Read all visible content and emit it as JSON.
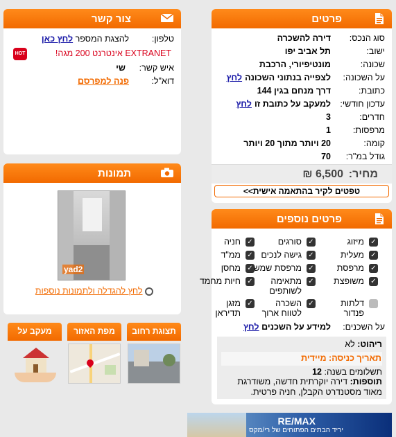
{
  "details": {
    "title": "פרטים",
    "rows": [
      {
        "label": "סוג הנכס:",
        "value": "דירה להשכרה"
      },
      {
        "label": "ישוב:",
        "value": "תל אביב יפו"
      },
      {
        "label": "שכונה:",
        "value": "מונטיפיורי, הרכבת"
      },
      {
        "label": "על השכונה:",
        "value": "לצפייה בנתוני השכונה",
        "link": "לחץ"
      },
      {
        "label": "כתובת:",
        "value": "דרך מנחם בגין 144"
      },
      {
        "label": "עדכון חודשי:",
        "value": "למעקב על כתובת זו",
        "link": "לחץ"
      },
      {
        "label": "חדרים:",
        "value": "3"
      },
      {
        "label": "מרפסות:",
        "value": "1"
      },
      {
        "label": "קומה:",
        "value": "20 ויותר מתוך 20 ויותר"
      },
      {
        "label": "גודל במ\"ר:",
        "value": "70"
      }
    ],
    "price_label": "מחיר:",
    "price_value": "6,500 ₪",
    "tips_button": "טפטים לקיר בהתאמה אישית>>"
  },
  "extra": {
    "title": "פרטים נוספים",
    "features": [
      {
        "label": "מיזוג",
        "checked": true
      },
      {
        "label": "סורגים",
        "checked": true
      },
      {
        "label": "חניה",
        "checked": true
      },
      {
        "label": "מעלית",
        "checked": true
      },
      {
        "label": "גישה לנכים",
        "checked": true
      },
      {
        "label": "ממ\"ד",
        "checked": true
      },
      {
        "label": "מרפסת",
        "checked": true
      },
      {
        "label": "מרפסת שמש",
        "checked": true
      },
      {
        "label": "מחסן",
        "checked": true
      },
      {
        "label": "משופצת",
        "checked": true
      },
      {
        "label": "מתאימה לשותפים",
        "checked": true
      },
      {
        "label": "חיות מחמד",
        "checked": true
      },
      {
        "label": "דלתות פנדור",
        "checked": false
      },
      {
        "label": "השכרה לטווח ארוך",
        "checked": true
      },
      {
        "label": "מזגן תדיראן",
        "checked": true
      }
    ],
    "neighbors_label": "על השכנים:",
    "neighbors_value": "למידע על השכנים",
    "neighbors_link": "לחץ",
    "furnished_label": "ריהוט:",
    "furnished_value": "לא",
    "entry_label": "תאריך כניסה:",
    "entry_value": "מיידית",
    "payments_label": "תשלומים בשנה:",
    "payments_value": "12",
    "additions_label": "תוספות:",
    "additions_value": "דירה יוקרתית חדשה, משודרגת מאוד מסטנדרט הקבלן, חניה פרטית."
  },
  "contact": {
    "title": "צור קשר",
    "phone_label": "טלפון:",
    "phone_text": "להצגת המספר",
    "phone_link": "לחץ כאן",
    "promo_text": "EXTRANET אינטרנט 200 מגה!",
    "person_label": "איש קשר:",
    "person_value": "שי",
    "email_label": "דוא\"ל:",
    "email_value": "פנה למפרסם"
  },
  "photos": {
    "title": "תמונות",
    "watermark": "yad2",
    "enlarge_link": "לחץ להגדלה ולתמונות נוספות"
  },
  "thumbs": [
    {
      "label": "תצוגת רחוב"
    },
    {
      "label": "מפת האזור"
    },
    {
      "label": "מעקב על הבית"
    }
  ],
  "banner": {
    "brand": "RE/MAX",
    "tagline": "יריד הבתים הפתוחים של רי/מקס"
  },
  "colors": {
    "accent": "#f26a00",
    "link": "#1a1aa8"
  }
}
